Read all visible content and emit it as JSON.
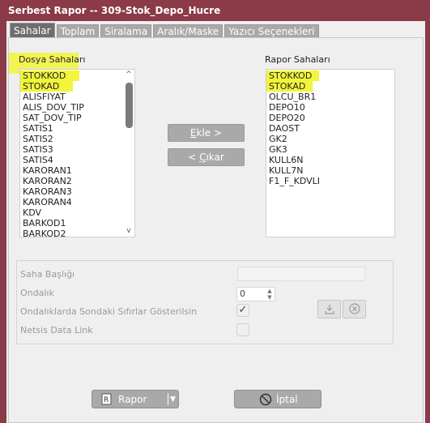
{
  "window": {
    "title": "Serbest Rapor -- 309-Stok_Depo_Hucre"
  },
  "tabs": [
    {
      "label": "Sahalar"
    },
    {
      "label": "Toplam"
    },
    {
      "label": "Siralama"
    },
    {
      "label": "Aralık/Maske"
    },
    {
      "label": "Yazıcı Seçenekleri"
    }
  ],
  "left_list": {
    "title": "Dosya Sahaları",
    "items": [
      "STOKKOD",
      "STOKAD",
      "ALISFIYAT",
      "ALIS_DOV_TIP",
      "SAT_DOV_TIP",
      "SATIS1",
      "SATIS2",
      "SATIS3",
      "SATIS4",
      "KARORAN1",
      "KARORAN2",
      "KARORAN3",
      "KARORAN4",
      "KDV",
      "BARKOD1",
      "BARKOD2"
    ]
  },
  "right_list": {
    "title": "Rapor Sahaları",
    "items": [
      "STOKKOD",
      "STOKAD",
      "OLCU_BR1",
      "DEPO10",
      "DEPO20",
      "DAOST",
      "GK2",
      "GK3",
      "KULL6N",
      "KULL7N",
      "F1_F_KDVLI"
    ]
  },
  "buttons": {
    "add_pre": "",
    "add_u": "E",
    "add_post": "kle >",
    "remove_pre": "< ",
    "remove_u": "Ç",
    "remove_post": "ıkar",
    "report_u": "R",
    "report_rest": "apor",
    "cancel_u": "İ",
    "cancel_rest": "ptal"
  },
  "options": {
    "field_title_label": "Saha Başlığı",
    "decimal_label": "Ondalık",
    "decimal_value": "0",
    "trailing_zeros_label": "Ondalıklarda Sondaki Sıfırlar Gösterilsin",
    "trailing_zeros_checked": true,
    "netsis_link_label": "Netsis Data Link",
    "netsis_link_checked": false
  },
  "colors": {
    "title_bar": "#8b3a48",
    "highlight": "#f2f53a",
    "button": "#a9a9a9"
  },
  "icons": {
    "save": "download-icon",
    "delete": "delete-icon",
    "report": "report-icon",
    "cancel": "prohibit-icon"
  }
}
